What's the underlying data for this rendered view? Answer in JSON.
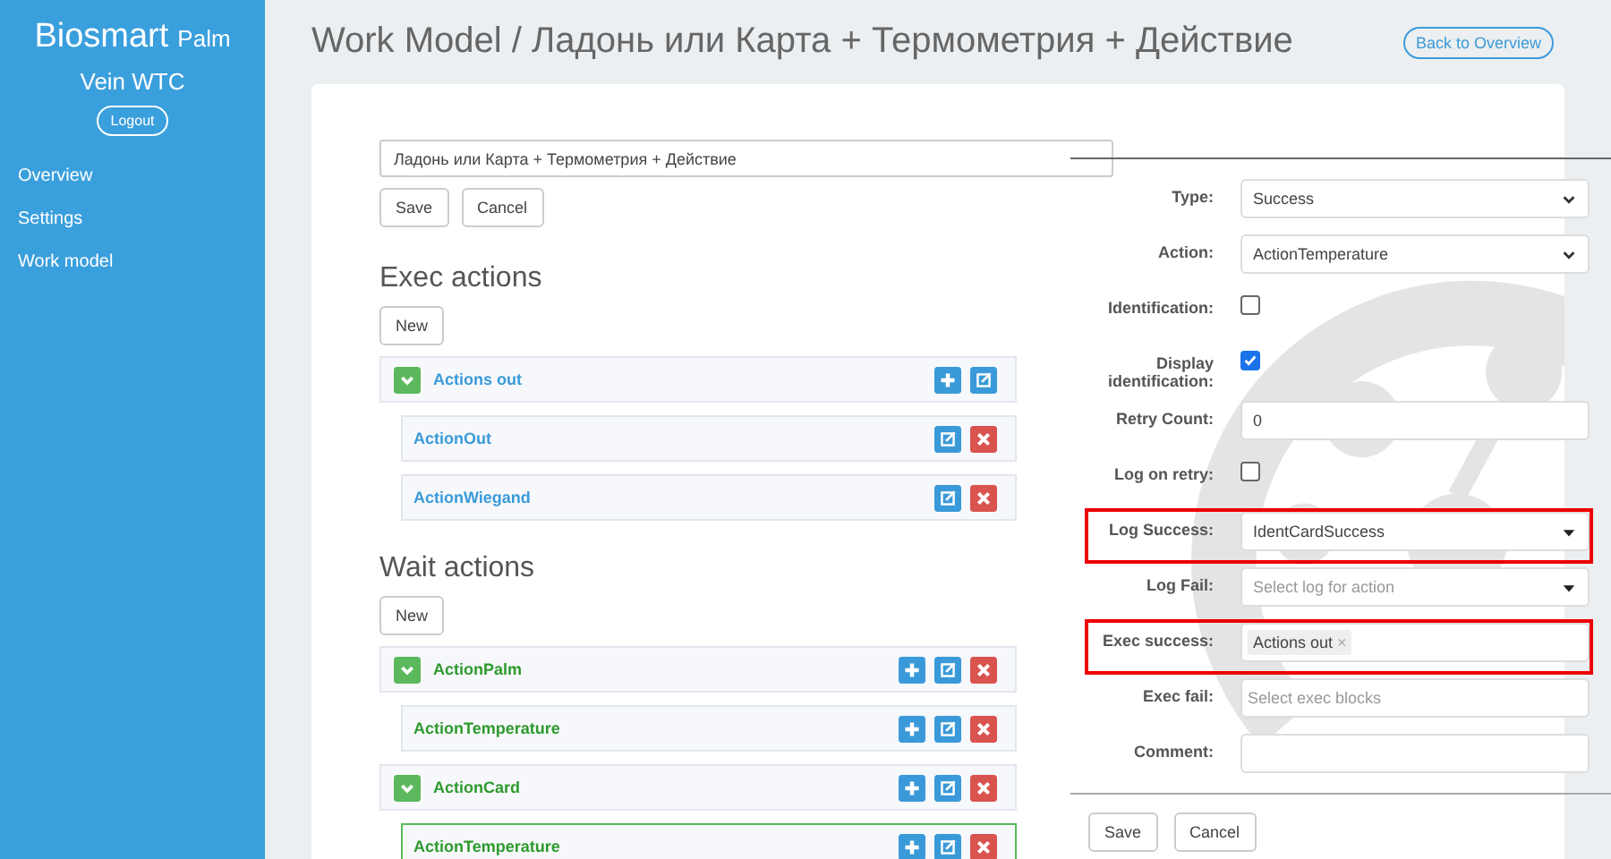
{
  "sidebar": {
    "brand": "Biosmart",
    "brand_suffix": "Palm",
    "brand_line2": "Vein WTC",
    "logout": "Logout",
    "items": [
      {
        "label": "Overview"
      },
      {
        "label": "Settings"
      },
      {
        "label": "Work model"
      }
    ]
  },
  "header": {
    "title": "Work Model / Ладонь или Карта + Термометрия + Действие",
    "back_button": "Back to Overview"
  },
  "model_form": {
    "name_value": "Ладонь или Карта + Термометрия + Действие",
    "save": "Save",
    "cancel": "Cancel"
  },
  "sections": [
    {
      "title": "Exec actions",
      "kind": "exec",
      "new_button": "New",
      "rows": [
        {
          "label": "Actions out",
          "expanded": true,
          "selected": false,
          "can_add": true,
          "can_edit": true,
          "can_delete": false,
          "children": [
            {
              "label": "ActionOut",
              "selected": false,
              "can_add": false,
              "can_edit": true,
              "can_delete": true
            },
            {
              "label": "ActionWiegand",
              "selected": false,
              "can_add": false,
              "can_edit": true,
              "can_delete": true
            }
          ]
        }
      ]
    },
    {
      "title": "Wait actions",
      "kind": "wait",
      "new_button": "New",
      "rows": [
        {
          "label": "ActionPalm",
          "expanded": true,
          "selected": false,
          "can_add": true,
          "can_edit": true,
          "can_delete": true,
          "children": [
            {
              "label": "ActionTemperature",
              "selected": false,
              "can_add": true,
              "can_edit": true,
              "can_delete": true
            }
          ]
        },
        {
          "label": "ActionCard",
          "expanded": true,
          "selected": false,
          "can_add": true,
          "can_edit": true,
          "can_delete": true,
          "children": [
            {
              "label": "ActionTemperature",
              "selected": true,
              "can_add": true,
              "can_edit": true,
              "can_delete": true
            }
          ]
        }
      ]
    }
  ],
  "action_form": {
    "fields": [
      {
        "kind": "select",
        "label": "Type:",
        "value": "Success",
        "highlighted": false
      },
      {
        "kind": "select",
        "label": "Action:",
        "value": "ActionTemperature",
        "highlighted": false
      },
      {
        "kind": "checkbox",
        "label": "Identification:",
        "checked": false,
        "highlighted": false
      },
      {
        "kind": "checkbox",
        "label": "Display identification:",
        "checked": true,
        "highlighted": false
      },
      {
        "kind": "input",
        "label": "Retry Count:",
        "value": "0",
        "highlighted": false
      },
      {
        "kind": "checkbox",
        "label": "Log on retry:",
        "checked": false,
        "highlighted": false
      },
      {
        "kind": "dropdown",
        "label": "Log Success:",
        "value": "IdentCardSuccess",
        "highlighted": true
      },
      {
        "kind": "dropdown",
        "label": "Log Fail:",
        "placeholder": "Select log for action",
        "highlighted": false
      },
      {
        "kind": "tags",
        "label": "Exec success:",
        "tags": [
          "Actions out"
        ],
        "tag_remove": "×",
        "highlighted": true
      },
      {
        "kind": "tags",
        "label": "Exec fail:",
        "placeholder": "Select exec blocks",
        "highlighted": false
      },
      {
        "kind": "input",
        "label": "Comment:",
        "highlighted": false
      }
    ],
    "save": "Save",
    "cancel": "Cancel"
  }
}
